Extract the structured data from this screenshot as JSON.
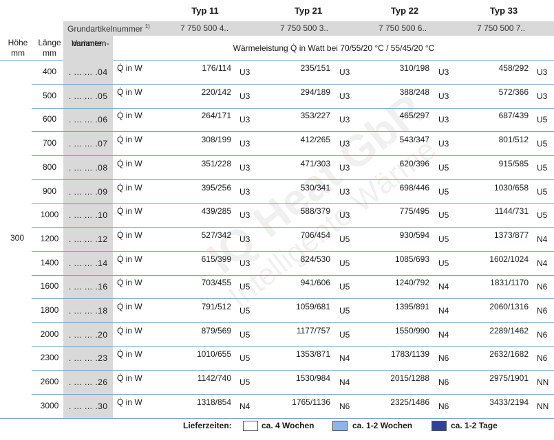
{
  "types": [
    "Typ 11",
    "Typ 21",
    "Typ 22",
    "Typ 33"
  ],
  "grundartikel_label": "Grundartikelnummer",
  "grundartikel_sup": "1)",
  "article_numbers": [
    "7 750 500 4..",
    "7 750 500 3..",
    "7 750 500 6..",
    "7 750 500 7.."
  ],
  "header": {
    "hoehe": "Höhe",
    "hoehe_unit": "mm",
    "laenge": "Länge",
    "laenge_unit": "mm",
    "varianten": "Varianten-",
    "varianten2": "nummer",
    "waerme": "Wärmeleistung Q̇ in Watt bei 70/55/20 °C / 55/45/20 °C"
  },
  "hoehe_value": "300",
  "q_label": "Q̇ in W",
  "rows": [
    {
      "len": "400",
      "var": ". ... ... .04",
      "v": [
        "176/114",
        "235/151",
        "310/198",
        "458/292"
      ],
      "lz": [
        "U3",
        "U3",
        "U3",
        "U3"
      ]
    },
    {
      "len": "500",
      "var": ". ... ... .05",
      "v": [
        "220/142",
        "294/189",
        "388/248",
        "572/366"
      ],
      "lz": [
        "U3",
        "U3",
        "U3",
        "U3"
      ]
    },
    {
      "len": "600",
      "var": ". ... ... .06",
      "v": [
        "264/171",
        "353/227",
        "465/297",
        "687/439"
      ],
      "lz": [
        "U3",
        "U3",
        "U3",
        "U5"
      ]
    },
    {
      "len": "700",
      "var": ". ... ... .07",
      "v": [
        "308/199",
        "412/265",
        "543/347",
        "801/512"
      ],
      "lz": [
        "U3",
        "U3",
        "U3",
        "U5"
      ]
    },
    {
      "len": "800",
      "var": ". ... ... .08",
      "v": [
        "351/228",
        "471/303",
        "620/396",
        "915/585"
      ],
      "lz": [
        "U3",
        "U3",
        "U5",
        "U5"
      ]
    },
    {
      "len": "900",
      "var": ". ... ... .09",
      "v": [
        "395/256",
        "530/341",
        "698/446",
        "1030/658"
      ],
      "lz": [
        "U3",
        "U3",
        "U5",
        "U5"
      ]
    },
    {
      "len": "1000",
      "var": ". ... ... .10",
      "v": [
        "439/285",
        "588/379",
        "775/495",
        "1144/731"
      ],
      "lz": [
        "U3",
        "U3",
        "U5",
        "U5"
      ]
    },
    {
      "len": "1200",
      "var": ". ... ... .12",
      "v": [
        "527/342",
        "706/454",
        "930/594",
        "1373/877"
      ],
      "lz": [
        "U3",
        "U5",
        "U5",
        "N4"
      ]
    },
    {
      "len": "1400",
      "var": ". ... ... .14",
      "v": [
        "615/399",
        "824/530",
        "1085/693",
        "1602/1024"
      ],
      "lz": [
        "U3",
        "U5",
        "U5",
        "N4"
      ]
    },
    {
      "len": "1600",
      "var": ". ... ... .16",
      "v": [
        "703/455",
        "941/606",
        "1240/792",
        "1831/1170"
      ],
      "lz": [
        "U5",
        "U5",
        "N4",
        "N6"
      ]
    },
    {
      "len": "1800",
      "var": ". ... ... .18",
      "v": [
        "791/512",
        "1059/681",
        "1395/891",
        "2060/1316"
      ],
      "lz": [
        "U5",
        "U5",
        "N4",
        "N6"
      ]
    },
    {
      "len": "2000",
      "var": ". ... ... .20",
      "v": [
        "879/569",
        "1177/757",
        "1550/990",
        "2289/1462"
      ],
      "lz": [
        "U5",
        "U5",
        "N4",
        "N6"
      ]
    },
    {
      "len": "2300",
      "var": ". ... ... .23",
      "v": [
        "1010/655",
        "1353/871",
        "1783/1139",
        "2632/1682"
      ],
      "lz": [
        "U5",
        "N4",
        "N6",
        "N6"
      ]
    },
    {
      "len": "2600",
      "var": ". ... ... .26",
      "v": [
        "1142/740",
        "1530/984",
        "2015/1288",
        "2975/1901"
      ],
      "lz": [
        "U5",
        "N4",
        "N6",
        "NN"
      ]
    },
    {
      "len": "3000",
      "var": ". ... ... .30",
      "v": [
        "1318/854",
        "1765/1136",
        "2325/1486",
        "3433/2194"
      ],
      "lz": [
        "N4",
        "N6",
        "N6",
        "NN"
      ]
    }
  ],
  "footer": {
    "label": "Lieferzeiten:",
    "items": [
      {
        "text": "ca. 4 Wochen",
        "color": "#ffffff"
      },
      {
        "text": "ca. 1-2 Wochen",
        "color": "#8fb4e6"
      },
      {
        "text": "ca. 1-2 Tage",
        "color": "#2f3f9e"
      }
    ]
  },
  "watermark": [
    "IQ Heat GbR",
    "Intelligente Wärme"
  ]
}
